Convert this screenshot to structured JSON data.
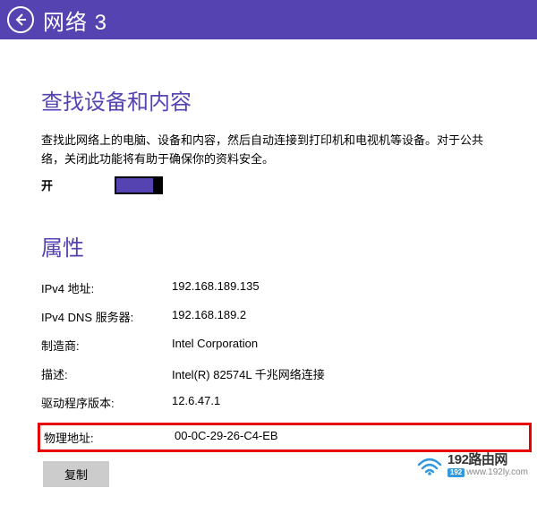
{
  "header": {
    "title": "网络  3"
  },
  "devices": {
    "title": "查找设备和内容",
    "desc": "查找此网络上的电脑、设备和内容，然后自动连接到打印机和电视机等设备。对于公共络，关闭此功能将有助于确保你的资料安全。",
    "toggle_label": "开"
  },
  "properties": {
    "title": "属性",
    "rows": [
      {
        "label": "IPv4 地址:",
        "value": "192.168.189.135"
      },
      {
        "label": "IPv4 DNS 服务器:",
        "value": "192.168.189.2"
      },
      {
        "label": "制造商:",
        "value": "Intel Corporation"
      },
      {
        "label": "描述:",
        "value": "Intel(R) 82574L 千兆网络连接"
      },
      {
        "label": "驱动程序版本:",
        "value": "12.6.47.1"
      }
    ],
    "highlighted": {
      "label": "物理地址:",
      "value": "00-0C-29-26-C4-EB"
    },
    "copy_label": "复制"
  },
  "watermark": {
    "brand": "192路由网",
    "badge": "192",
    "url": "www.192ly.com"
  }
}
